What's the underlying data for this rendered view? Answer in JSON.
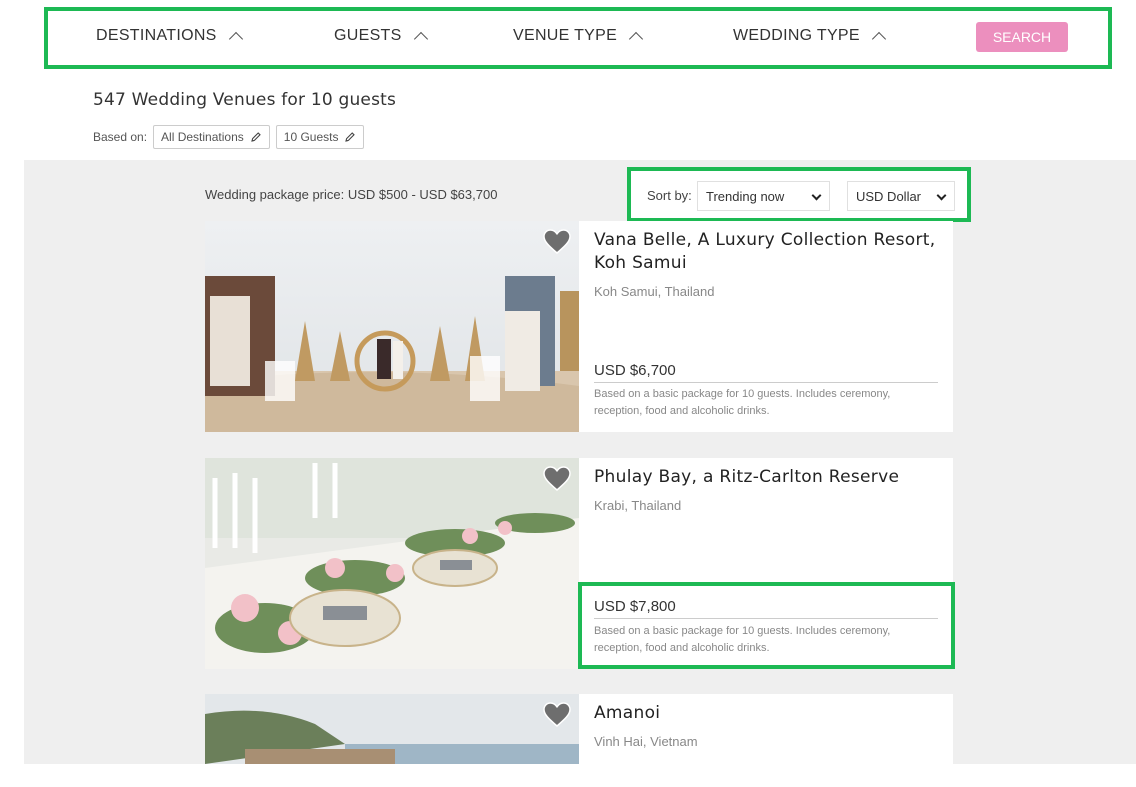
{
  "filters": {
    "destinations": "DESTINATIONS",
    "guests": "GUESTS",
    "venue_type": "VENUE TYPE",
    "wedding_type": "WEDDING TYPE",
    "search": "SEARCH"
  },
  "results": {
    "title": "547 Wedding Venues for 10 guests",
    "based_on_label": "Based on:",
    "chips": [
      "All Destinations",
      "10 Guests"
    ]
  },
  "price_range": "Wedding package price:  USD $500 - USD $63,700",
  "sort": {
    "label": "Sort by:",
    "selected": "Trending now",
    "currency": "USD Dollar"
  },
  "venues": [
    {
      "name": "Vana Belle, A Luxury Collection Resort, Koh Samui",
      "location": "Koh Samui, Thailand",
      "price": "USD $6,700",
      "description": "Based on a basic package for 10 guests. Includes ceremony, reception, food and alcoholic drinks."
    },
    {
      "name": "Phulay Bay, a Ritz-Carlton Reserve",
      "location": "Krabi, Thailand",
      "price": "USD $7,800",
      "description": "Based on a basic package for 10 guests. Includes ceremony, reception, food and alcoholic drinks."
    },
    {
      "name": "Amanoi",
      "location": "Vinh Hai, Vietnam"
    }
  ],
  "colors": {
    "highlight": "#1db954",
    "search_button": "#ec8fbe",
    "page_background": "#efefef"
  },
  "icons": [
    "chevron-up-icon",
    "pencil-icon",
    "heart-icon",
    "chevron-down-icon"
  ]
}
